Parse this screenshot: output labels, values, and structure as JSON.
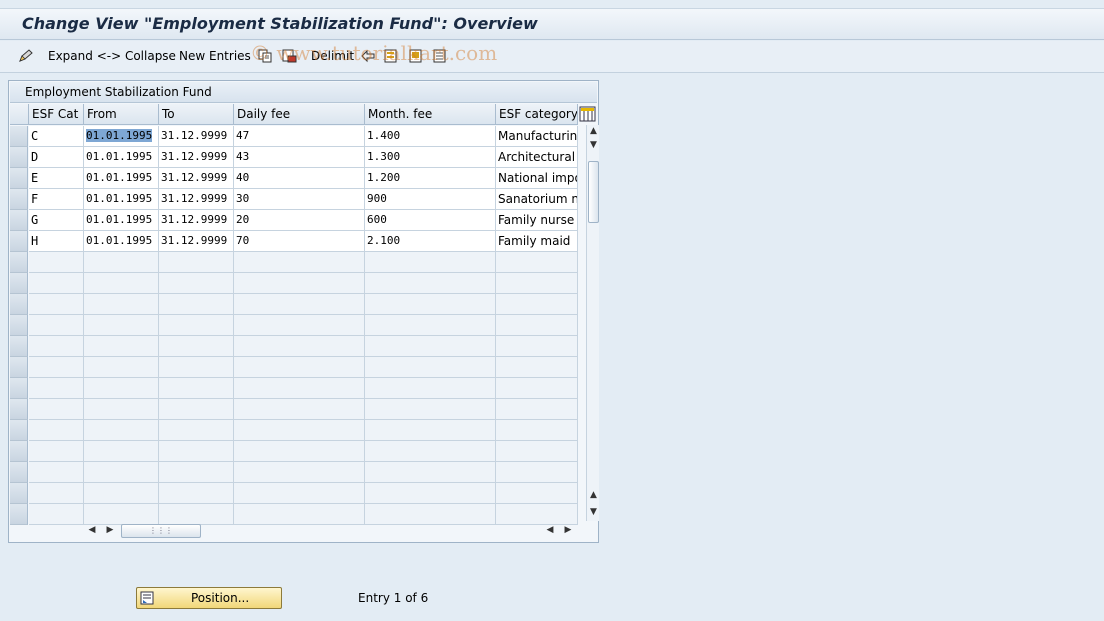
{
  "window": {
    "title": "Change View \"Employment Stabilization Fund\": Overview"
  },
  "toolbar": {
    "expand_collapse": "Expand <-> Collapse",
    "new_entries": "New Entries",
    "delimit": "Delimit",
    "watermark": "© www.tutorialkart.com"
  },
  "panel": {
    "title": "Employment Stabilization Fund"
  },
  "table": {
    "columns": [
      "ESF Cat",
      "From",
      "To",
      "Daily fee",
      "Month. fee",
      "ESF category t"
    ],
    "rows": [
      [
        "C",
        "01.01.1995",
        "31.12.9999",
        "47",
        "1.400",
        "Manufacturing"
      ],
      [
        "D",
        "01.01.1995",
        "31.12.9999",
        "43",
        "1.300",
        "Architectural la"
      ],
      [
        "E",
        "01.01.1995",
        "31.12.9999",
        "40",
        "1.200",
        "National impor"
      ],
      [
        "F",
        "01.01.1995",
        "31.12.9999",
        "30",
        "900",
        "Sanatorium nur"
      ],
      [
        "G",
        "01.01.1995",
        "31.12.9999",
        "20",
        "600",
        "Family nurse"
      ],
      [
        "H",
        "01.01.1995",
        "31.12.9999",
        "70",
        "2.100",
        "Family maid"
      ]
    ]
  },
  "footer": {
    "position_button": "Position...",
    "entry_info": "Entry 1 of 6"
  },
  "colors": {
    "accent": "#7ea7d4",
    "button": "#f1d779"
  }
}
